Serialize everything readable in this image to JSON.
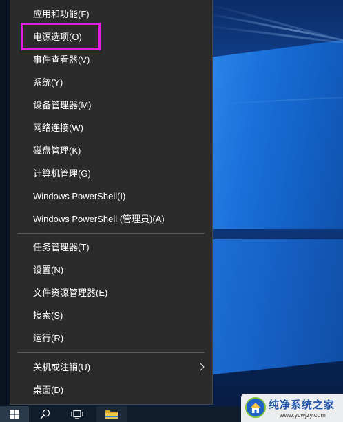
{
  "menu": {
    "groups": [
      {
        "items": [
          {
            "label": "应用和功能(F)"
          },
          {
            "label": "电源选项(O)",
            "annotated": true
          },
          {
            "label": "事件查看器(V)"
          },
          {
            "label": "系统(Y)"
          },
          {
            "label": "设备管理器(M)"
          },
          {
            "label": "网络连接(W)"
          },
          {
            "label": "磁盘管理(K)"
          },
          {
            "label": "计算机管理(G)"
          },
          {
            "label": "Windows PowerShell(I)"
          },
          {
            "label": "Windows PowerShell (管理员)(A)"
          }
        ]
      },
      {
        "items": [
          {
            "label": "任务管理器(T)"
          },
          {
            "label": "设置(N)"
          },
          {
            "label": "文件资源管理器(E)"
          },
          {
            "label": "搜索(S)"
          },
          {
            "label": "运行(R)"
          }
        ]
      },
      {
        "items": [
          {
            "label": "关机或注销(U)",
            "has_submenu": true,
            "icon": "chevron-right-icon"
          },
          {
            "label": "桌面(D)"
          }
        ]
      }
    ]
  },
  "taskbar": {
    "buttons": [
      {
        "icon": "windows-logo-icon",
        "active": true
      },
      {
        "icon": "search-icon"
      },
      {
        "icon": "task-view-icon"
      },
      {
        "icon": "file-explorer-icon"
      }
    ]
  },
  "watermark": {
    "title": "纯净系统之家",
    "url": "www.ycwjzy.com"
  },
  "colors": {
    "menu_background": "#2b2b2b",
    "menu_border": "#474747",
    "menu_text": "#ffffff",
    "separator": "#5a5a5a",
    "annotation_box": "#e31ee3",
    "taskbar_background": "#0f1c2b",
    "start_button_active": "#2b3a4b",
    "watermark_text": "#1b4fa6"
  }
}
